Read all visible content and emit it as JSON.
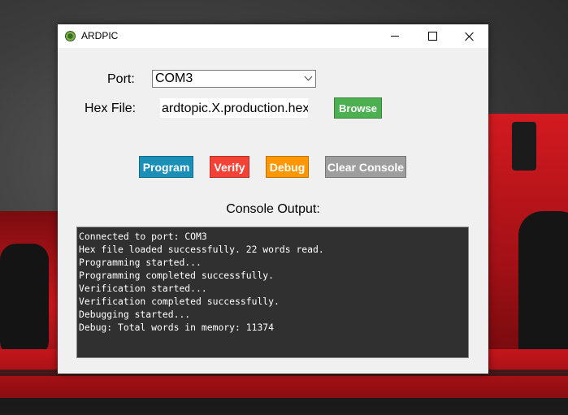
{
  "window": {
    "title": "ARDPIC",
    "icon": "chip-icon",
    "controls": [
      "minimize-icon",
      "maximize-icon",
      "close-icon"
    ]
  },
  "form": {
    "port_label": "Port:",
    "port_value": "COM3",
    "hex_label": "Hex File:",
    "hex_value": "ardtopic.X.production.hex",
    "browse_label": "Browse"
  },
  "actions": {
    "program": "Program",
    "verify": "Verify",
    "debug": "Debug",
    "clear": "Clear Console"
  },
  "console": {
    "label": "Console Output:",
    "lines": [
      "Connected to port: COM3",
      "Hex file loaded successfully. 22 words read.",
      "Programming started...",
      "Programming completed successfully.",
      "Verification started...",
      "Verification completed successfully.",
      "Debugging started...",
      "Debug: Total words in memory: 11374"
    ]
  },
  "colors": {
    "browse": "#4caf50",
    "program": "#1a8fb8",
    "verify": "#f44336",
    "debug": "#ff9800",
    "clear": "#9e9e9e",
    "console_bg": "#303030"
  }
}
